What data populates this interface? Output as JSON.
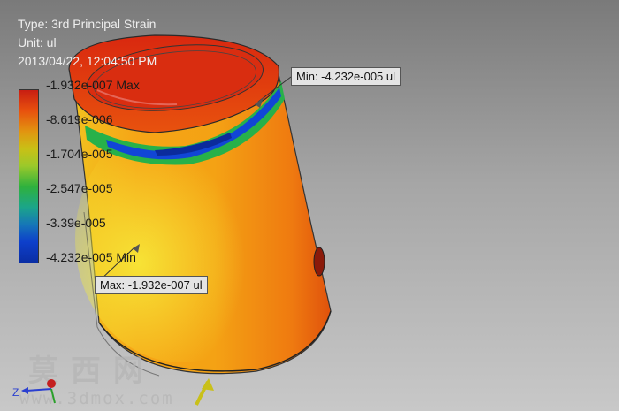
{
  "header": {
    "type_line": "Type: 3rd Principal Strain",
    "unit_line": "Unit: ul",
    "date_line": "2013/04/22, 12:04:50 PM"
  },
  "legend": {
    "ticks": [
      "-1.932e-007 Max",
      "-8.619e-006",
      "-1.704e-005",
      "-2.547e-005",
      "-3.39e-005",
      "-4.232e-005 Min"
    ],
    "colors": [
      "#c81e12",
      "#e8510e",
      "#e29510",
      "#c9c016",
      "#9bc92a",
      "#2fb13d",
      "#1ba58a",
      "#1676b8",
      "#0d3fcb",
      "#0a2ea4"
    ]
  },
  "callouts": {
    "min_label": "Min: -4.232e-005 ul",
    "max_label": "Max: -1.932e-007 ul"
  },
  "triad": {
    "z_label": "Z",
    "icon": "view-triad-icon"
  },
  "watermark": {
    "cn": "莫西网",
    "url": "www.3dmox.com"
  },
  "colors": {
    "background_top": "#7a7a7a",
    "background_bottom": "#c8c8c8",
    "callout_bg": "#e4e4e4"
  }
}
